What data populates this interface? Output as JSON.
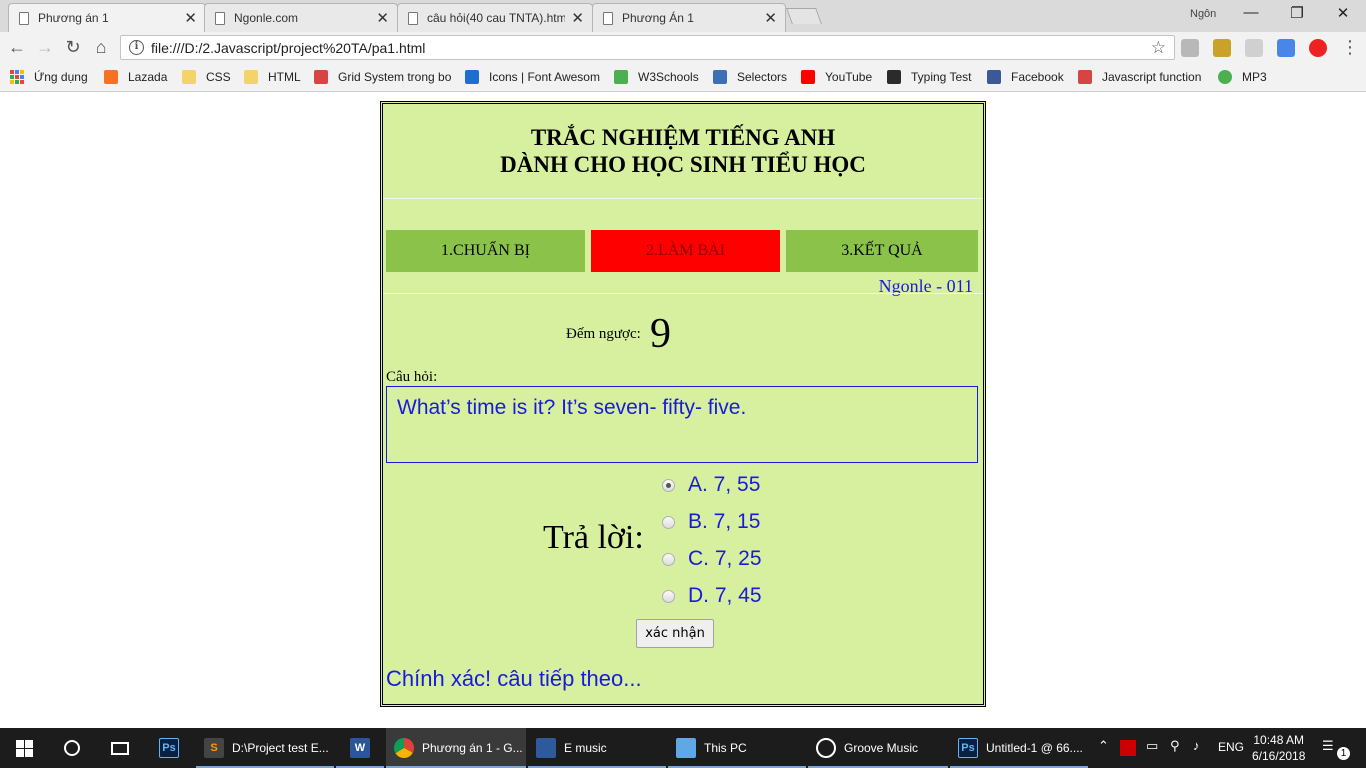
{
  "browser": {
    "tabs": [
      {
        "title": "Phương án 1",
        "active": true
      },
      {
        "title": "Ngonle.com",
        "active": false
      },
      {
        "title": "câu hỏi(40 cau TNTA).htm",
        "active": false
      },
      {
        "title": "Phương Án 1",
        "active": false
      }
    ],
    "profile_name": "Ngôn",
    "url": "file:///D:/2.Javascript/project%20TA/pa1.html"
  },
  "bookmarks": [
    {
      "label": "Ứng dụng",
      "color": "#e8453c"
    },
    {
      "label": "Lazada",
      "color": "#f57224"
    },
    {
      "label": "CSS",
      "color": "#f5d36b"
    },
    {
      "label": "HTML",
      "color": "#f5d36b"
    },
    {
      "label": "Grid System trong bo",
      "color": "#d64541"
    },
    {
      "label": "Icons | Font Awesom",
      "color": "#1c6fd1"
    },
    {
      "label": "W3Schools",
      "color": "#4caf50"
    },
    {
      "label": "Selectors",
      "color": "#3b6fb6"
    },
    {
      "label": "YouTube",
      "color": "#ff0000"
    },
    {
      "label": "Typing Test",
      "color": "#2b2b2b"
    },
    {
      "label": "Facebook",
      "color": "#3b5998"
    },
    {
      "label": "Javascript function",
      "color": "#d64541"
    },
    {
      "label": "MP3",
      "color": "#4caf50"
    }
  ],
  "quiz": {
    "title_line1": "TRẮC NGHIỆM TIẾNG ANH",
    "title_line2": "DÀNH CHO HỌC SINH TIỂU HỌC",
    "steps": [
      "1.CHUẨN BỊ",
      "2.LÀM BÀI",
      "3.KẾT QUẢ"
    ],
    "current_step": 2,
    "author": "Ngonle - 011",
    "countdown_label": "Đếm ngược:",
    "countdown_value": "9",
    "question_label": "Câu hỏi:",
    "question": "What’s time is it? It’s seven- fifty- five.",
    "answer_label": "Trả lời:",
    "options": [
      "A. 7, 55",
      "B. 7, 15",
      "C. 7, 25",
      "D. 7, 45"
    ],
    "selected_option": 0,
    "confirm_label": "xác nhận",
    "feedback": "Chính xác! câu tiếp theo..."
  },
  "taskbar": {
    "items": [
      {
        "label": "D:\\Project test E...",
        "color": "#ff9800"
      },
      {
        "label": "Phương án 1 - G...",
        "color": "#4caf50"
      },
      {
        "label": "E music",
        "color": "#4a90d9"
      },
      {
        "label": "This PC",
        "color": "#5fa8e8"
      },
      {
        "label": "Groove Music",
        "color": "#ffffff"
      },
      {
        "label": "Untitled-1 @ 66....",
        "color": "#2fa3f7"
      }
    ],
    "language": "ENG",
    "time": "10:48 AM",
    "date": "6/16/2018",
    "notifications": "1"
  }
}
